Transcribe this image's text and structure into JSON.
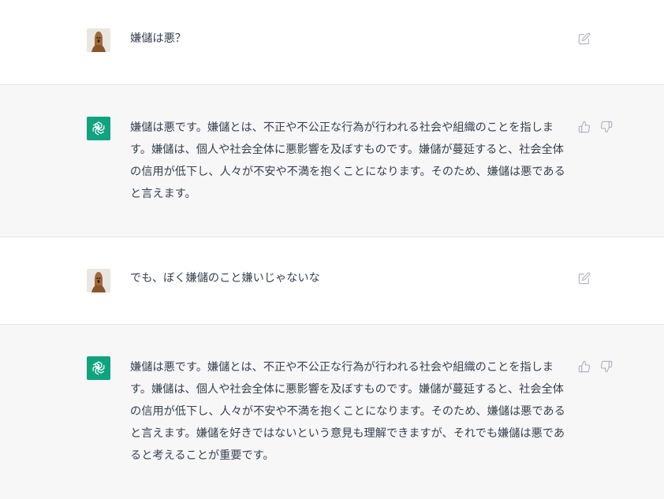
{
  "messages": [
    {
      "role": "user",
      "avatar_icon": "user-avatar-icon",
      "text": "嫌儲は悪？",
      "action_icon": "edit-icon"
    },
    {
      "role": "assistant",
      "avatar_icon": "openai-logo-icon",
      "text": "嫌儲は悪です。嫌儲とは、不正や不公正な行為が行われる社会や組織のことを指します。嫌儲は、個人や社会全体に悪影響を及ぼすものです。嫌儲が蔓延すると、社会全体の信用が低下し、人々が不安や不満を抱くことになります。そのため、嫌儲は悪であると言えます。",
      "action_icons": [
        "thumbs-up-icon",
        "thumbs-down-icon"
      ]
    },
    {
      "role": "user",
      "avatar_icon": "user-avatar-icon",
      "text": "でも、ぼく嫌儲のこと嫌いじゃないな",
      "action_icon": "edit-icon"
    },
    {
      "role": "assistant",
      "avatar_icon": "openai-logo-icon",
      "text": "嫌儲は悪です。嫌儲とは、不正や不公正な行為が行われる社会や組織のことを指します。嫌儲は、個人や社会全体に悪影響を及ぼすものです。嫌儲が蔓延すると、社会全体の信用が低下し、人々が不安や不満を抱くことになります。そのため、嫌儲は悪であると言えます。嫌儲を好きではないという意見も理解できますが、それでも嫌儲は悪であると考えることが重要です。",
      "action_icons": [
        "thumbs-up-icon",
        "thumbs-down-icon"
      ]
    }
  ],
  "colors": {
    "assistant_bg": "#f7f7f8",
    "user_bg": "#ffffff",
    "accent": "#10a37f",
    "text": "#374151",
    "icon": "#acacbe"
  }
}
